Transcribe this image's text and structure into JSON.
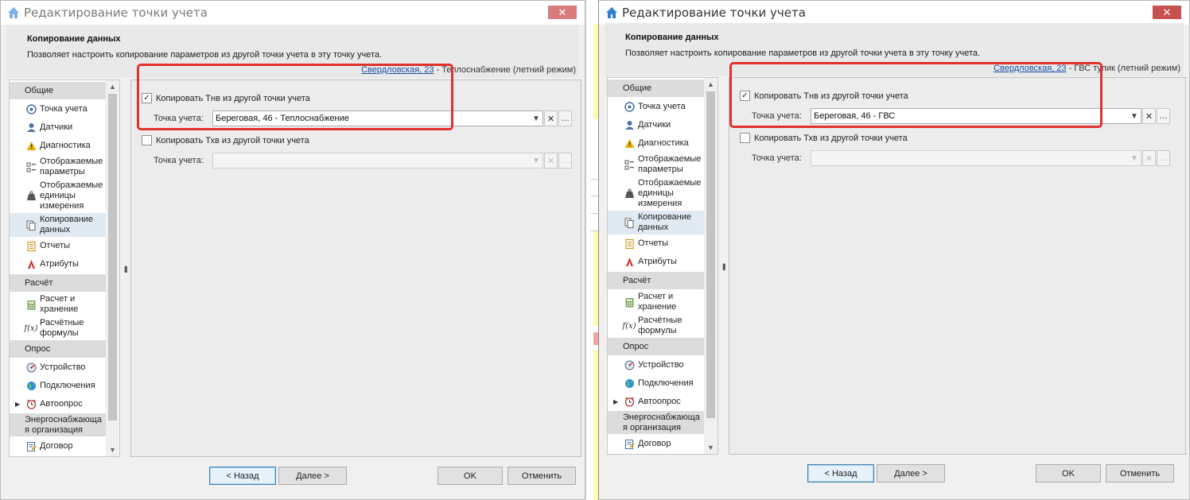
{
  "dialogs": [
    {
      "title": "Редактирование точки учета",
      "close": "✕",
      "header": {
        "title": "Копирование данных",
        "description": "Позволяет настроить копирование параметров из другой точки учета в эту точку учета.",
        "link": "Свердловская, 23",
        "link_suffix": " - Теплоснабжение (летний режим)"
      },
      "sidebar": {
        "groups": [
          "Общие",
          "Расчёт",
          "Опрос",
          "Энергоснабжающа я организация"
        ],
        "items": [
          "Точка учета",
          "Датчики",
          "Диагностика",
          "Отображаемые параметры",
          "Отображаемые единицы измерения",
          "Копирование данных",
          "Отчеты",
          "Атрибуты",
          "Расчет и хранение",
          "Расчётные формулы",
          "Устройство",
          "Подключения",
          "Автоопрос",
          "Договор"
        ]
      },
      "form": {
        "copy_tnv_label": "Копировать Тнв из другой точки учета",
        "copy_tnv_checked": true,
        "point_label": "Точка учета:",
        "point_value": "Береговая, 46 - Теплоснабжение",
        "copy_txv_label": "Копировать Тхв из другой точки учета",
        "copy_txv_checked": false,
        "point2_label": "Точка учета:",
        "point2_value": ""
      },
      "buttons": {
        "back": "< Назад",
        "next": "Далее >",
        "ok": "OK",
        "cancel": "Отменить"
      }
    },
    {
      "title": "Редактирование точки учета",
      "close": "✕",
      "header": {
        "title": "Копирование данных",
        "description": "Позволяет настроить копирование параметров из другой точки учета в эту точку учета.",
        "link": "Свердловская, 23",
        "link_suffix": " - ГВС тупик (летний режим)"
      },
      "sidebar": {
        "groups": [
          "Общие",
          "Расчёт",
          "Опрос",
          "Энергоснабжающа я организация"
        ],
        "items": [
          "Точка учета",
          "Датчики",
          "Диагностика",
          "Отображаемые параметры",
          "Отображаемые единицы измерения",
          "Копирование данных",
          "Отчеты",
          "Атрибуты",
          "Расчет и хранение",
          "Расчётные формулы",
          "Устройство",
          "Подключения",
          "Автоопрос",
          "Договор"
        ]
      },
      "form": {
        "copy_tnv_label": "Копировать Тнв из другой точки учета",
        "copy_tnv_checked": true,
        "point_label": "Точка учета:",
        "point_value": "Береговая, 46 - ГВС",
        "copy_txv_label": "Копировать Тхв из другой точки учета",
        "copy_txv_checked": false,
        "point2_label": "Точка учета:",
        "point2_value": ""
      },
      "buttons": {
        "back": "< Назад",
        "next": "Далее >",
        "ok": "OK",
        "cancel": "Отменить"
      }
    }
  ],
  "icons": [
    "home-icon",
    "close-icon",
    "point-icon",
    "sensor-icon",
    "warning-icon",
    "params-icon",
    "weight-icon",
    "copy-icon",
    "report-icon",
    "attribute-icon",
    "calculator-icon",
    "formula-icon",
    "device-icon",
    "globe-icon",
    "clock-icon",
    "contract-icon",
    "chevron-down-icon",
    "clear-icon",
    "ellipsis-icon"
  ],
  "colors": {
    "highlight": "#e0322c",
    "link": "#1a4fa8",
    "selection": "#e1e9f2",
    "close": "#c75050"
  }
}
